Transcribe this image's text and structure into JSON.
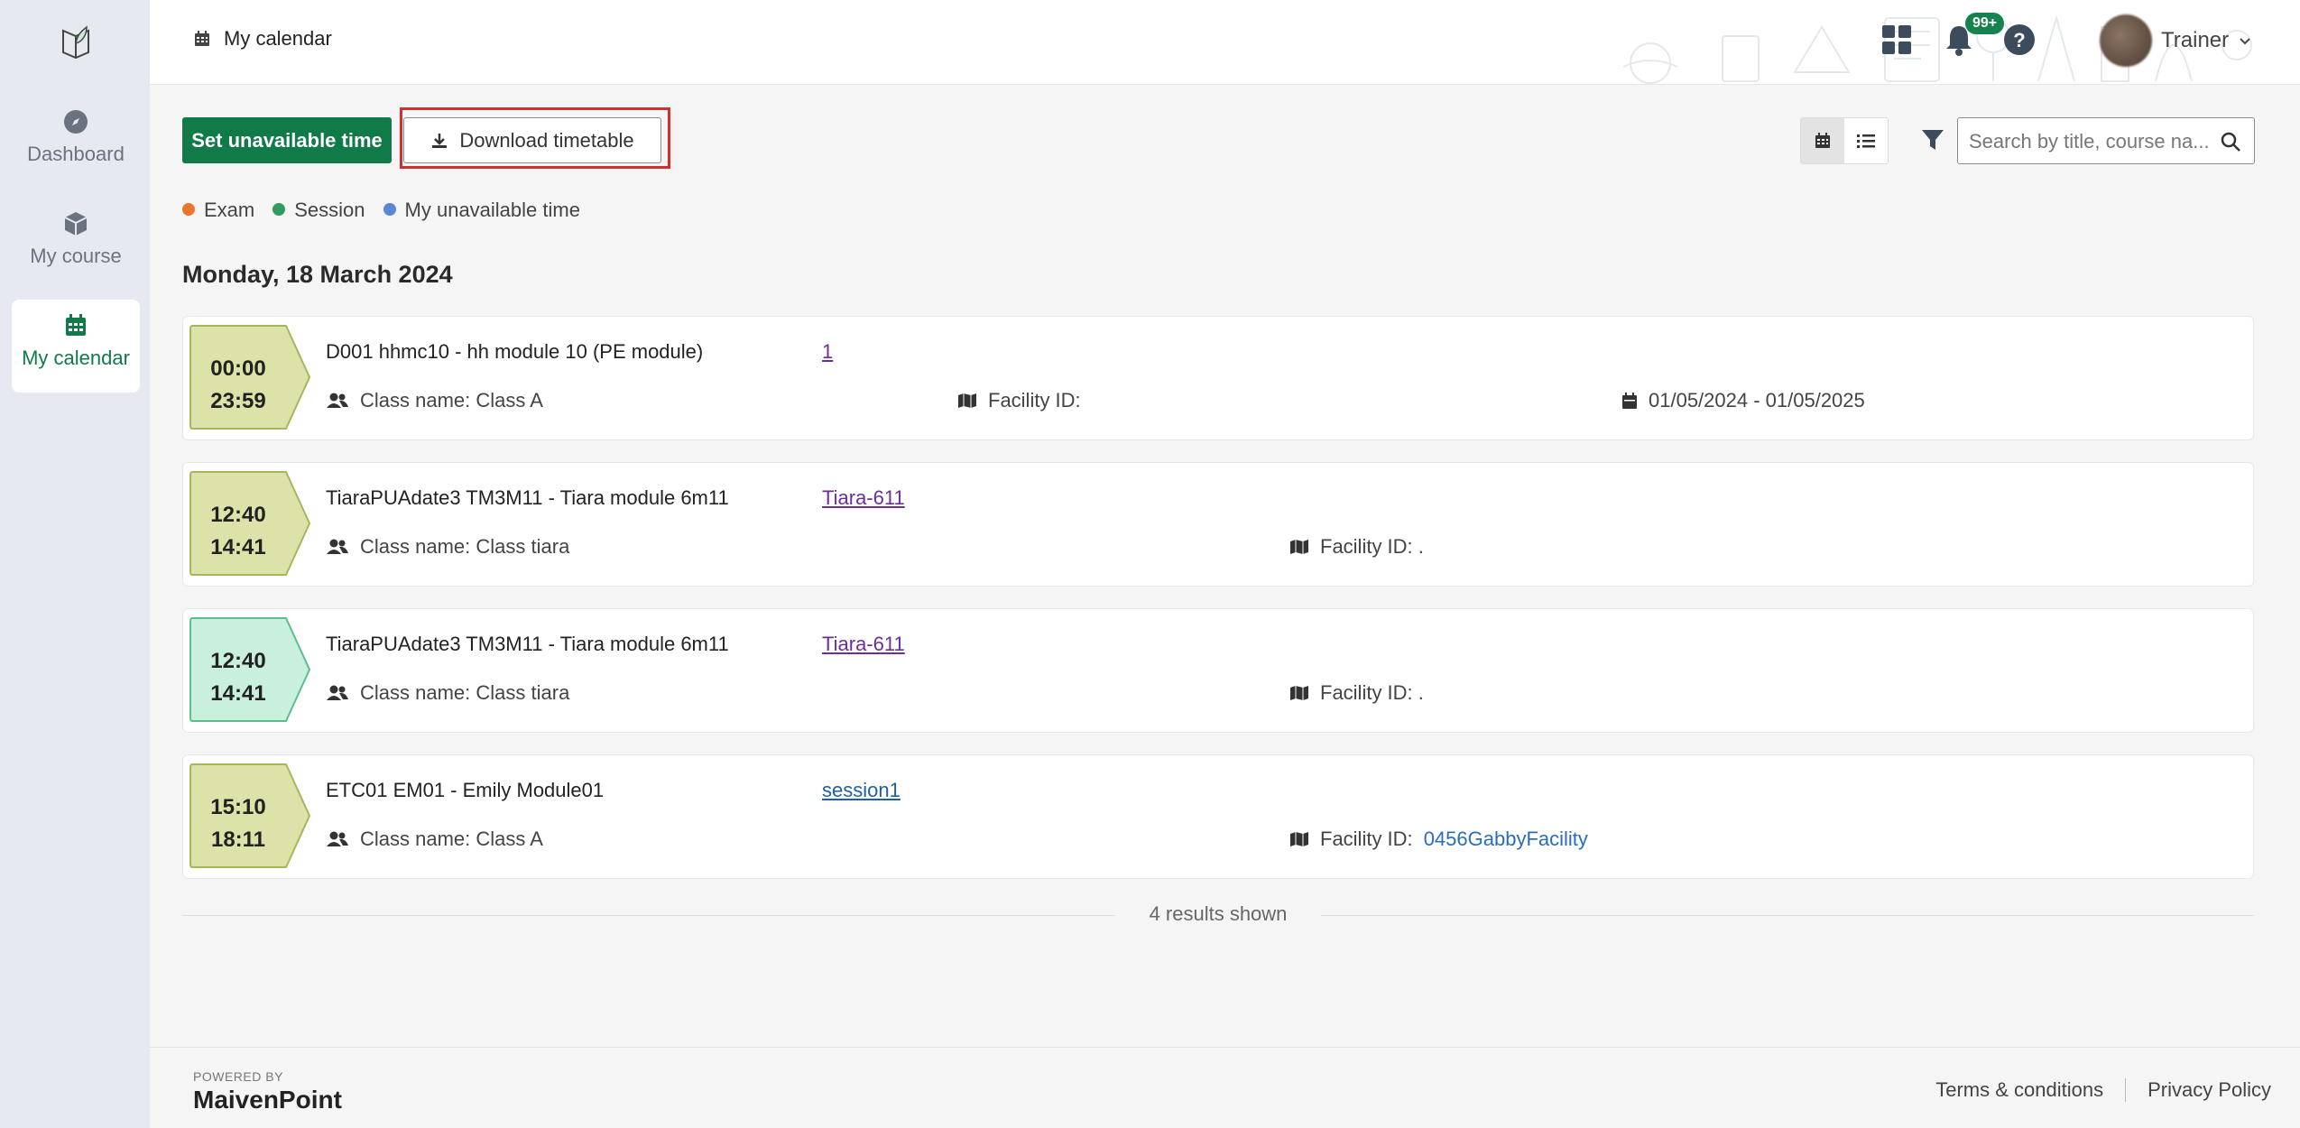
{
  "sidebar": {
    "logo_icon": "book-leaf-icon",
    "items": [
      {
        "label": "Dashboard",
        "icon": "compass-icon",
        "active": false
      },
      {
        "label": "My course",
        "icon": "box-icon",
        "active": false
      },
      {
        "label": "My calendar",
        "icon": "calendar-icon",
        "active": true
      }
    ]
  },
  "header": {
    "title": "My calendar",
    "notifications_badge": "99+",
    "user_name": "Trainer"
  },
  "toolbar": {
    "set_unavailable_label": "Set unavailable time",
    "download_label": "Download timetable",
    "search_placeholder": "Search by title, course na..."
  },
  "legend": [
    {
      "label": "Exam",
      "color": "#e8762c"
    },
    {
      "label": "Session",
      "color": "#2e9d5e"
    },
    {
      "label": "My unavailable time",
      "color": "#5a86d6"
    }
  ],
  "date_heading": "Monday, 18 March 2024",
  "events": [
    {
      "start": "00:00",
      "end": "23:59",
      "badge_color": "#dde3a8",
      "badge_border": "#a9b55c",
      "title": "D001 hhmc10 - hh module 10 (PE module)",
      "link": "1",
      "class_name": "Class name: Class A",
      "facility_label": "Facility ID:",
      "facility_value": "",
      "date_range": "01/05/2024 - 01/05/2025"
    },
    {
      "start": "12:40",
      "end": "14:41",
      "badge_color": "#dde3a8",
      "badge_border": "#a9b55c",
      "title": "TiaraPUAdate3 TM3M11 - Tiara module 6m11",
      "link": "Tiara-611",
      "class_name": "Class name: Class tiara",
      "facility_label": "Facility ID: .",
      "facility_value": ""
    },
    {
      "start": "12:40",
      "end": "14:41",
      "badge_color": "#c8f0dd",
      "badge_border": "#5bbf8d",
      "title": "TiaraPUAdate3 TM3M11 - Tiara module 6m11",
      "link": "Tiara-611",
      "class_name": "Class name: Class tiara",
      "facility_label": "Facility ID: .",
      "facility_value": ""
    },
    {
      "start": "15:10",
      "end": "18:11",
      "badge_color": "#dde3a8",
      "badge_border": "#a9b55c",
      "title": "ETC01 EM01 - Emily Module01",
      "link": "session1",
      "class_name": "Class name: Class A",
      "facility_label": "Facility ID:",
      "facility_value": "0456GabbyFacility"
    }
  ],
  "results_text": "4 results shown",
  "footer": {
    "powered_by": "POWERED BY",
    "brand": "MaivenPoint",
    "terms": "Terms & conditions",
    "privacy": "Privacy Policy"
  }
}
